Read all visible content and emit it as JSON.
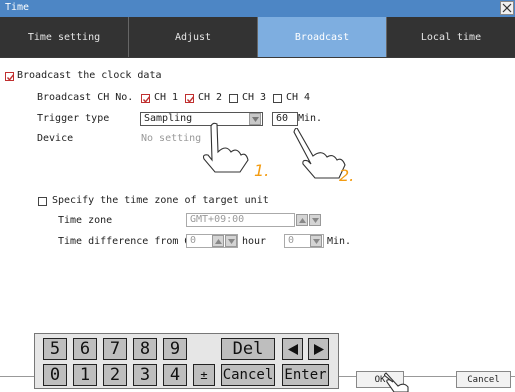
{
  "window": {
    "title": "Time",
    "close_icon": "close-icon"
  },
  "tabs": [
    {
      "label": "Time setting",
      "active": false
    },
    {
      "label": "Adjust",
      "active": false
    },
    {
      "label": "Broadcast",
      "active": true
    },
    {
      "label": "Local time",
      "active": false
    }
  ],
  "broadcast": {
    "enable_label": "Broadcast the clock data",
    "enable_checked": true,
    "ch_no_label": "Broadcast CH No.",
    "channels": [
      {
        "label": "CH 1",
        "checked": true
      },
      {
        "label": "CH 2",
        "checked": true
      },
      {
        "label": "CH 3",
        "checked": false
      },
      {
        "label": "CH 4",
        "checked": false
      }
    ],
    "trigger_label": "Trigger type",
    "trigger_value": "Sampling",
    "interval_value": "60",
    "interval_unit": "Min.",
    "device_label": "Device",
    "device_value": "No setting"
  },
  "timezone": {
    "enable_label": "Specify the time zone of target unit",
    "enable_checked": false,
    "zone_label": "Time zone",
    "zone_value": "GMT+09:00",
    "diff_label": "Time difference from GMT",
    "hour_value": "0",
    "hour_unit": "hour",
    "min_value": "0",
    "min_unit": "Min."
  },
  "keypad": {
    "row1": [
      "5",
      "6",
      "7",
      "8",
      "9"
    ],
    "row2": [
      "0",
      "1",
      "2",
      "3",
      "4"
    ],
    "del": "Del",
    "sign": "±",
    "cancel": "Cancel",
    "enter": "Enter"
  },
  "buttons": {
    "ok": "OK",
    "cancel": "Cancel"
  },
  "annotations": {
    "step1": "1.",
    "step2": "2."
  },
  "colors": {
    "title_bar": "#4d86c5",
    "tab_active": "#7eaee0",
    "tab_inactive": "#333333",
    "annotation": "#f39c12",
    "check_red": "#c03030"
  }
}
